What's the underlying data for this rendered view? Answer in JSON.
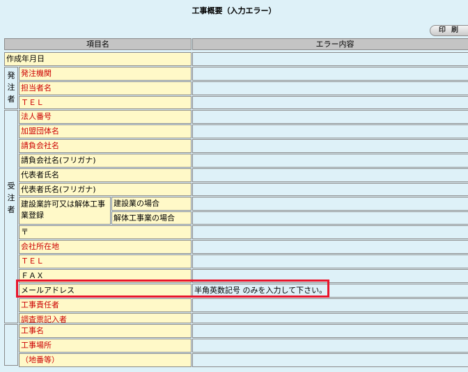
{
  "page": {
    "title": "工事概要（入力エラー）",
    "print_label": "印刷",
    "highlight_color": "#e8152b"
  },
  "table": {
    "col_item": "項目名",
    "col_error": "エラー内容",
    "row_created_date": "作成年月日",
    "orderer_group": [
      "発",
      "注",
      "者"
    ],
    "orderer_rows": [
      "発注機関",
      "担当者名",
      "ＴＥＬ"
    ],
    "contractor_group": [
      "受",
      "注",
      "者"
    ],
    "contractor_rows_a": [
      "法人番号",
      "加盟団体名",
      "請負会社名",
      "請負会社名(フリガナ)",
      "代表者氏名",
      "代表者氏名(フリガナ)"
    ],
    "license_label": "建設業許可又は解体工事業登録",
    "license_sub": [
      "建設業の場合",
      "解体工事業の場合"
    ],
    "contractor_rows_b": [
      "〒",
      "会社所在地",
      "ＴＥＬ",
      "ＦＡＸ",
      "メールアドレス",
      "工事責任者",
      "調査票記入者"
    ],
    "email_error": "半角英数記号 のみを入力して下さい。",
    "project_rows": [
      "工事名",
      "工事場所",
      "（地番等）"
    ]
  }
}
